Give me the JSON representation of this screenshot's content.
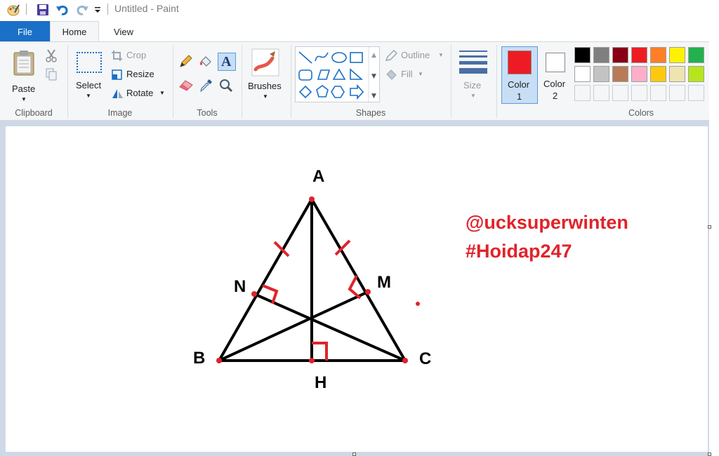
{
  "titlebar": {
    "title": "Untitled - Paint"
  },
  "tabs": {
    "file": "File",
    "home": "Home",
    "view": "View"
  },
  "clipboard": {
    "paste_label": "Paste",
    "group_label": "Clipboard"
  },
  "image": {
    "select_label": "Select",
    "crop_label": "Crop",
    "resize_label": "Resize",
    "rotate_label": "Rotate",
    "group_label": "Image"
  },
  "tools": {
    "group_label": "Tools"
  },
  "brushes": {
    "label": "Brushes"
  },
  "shapes": {
    "outline_label": "Outline",
    "fill_label": "Fill",
    "group_label": "Shapes"
  },
  "size": {
    "label": "Size"
  },
  "color1": {
    "label": "Color",
    "number": "1",
    "value": "#ed1c24"
  },
  "color2": {
    "label": "Color",
    "number": "2",
    "value": "#ffffff"
  },
  "colors": {
    "group_label": "Colors",
    "palette_row1": [
      "#000000",
      "#7f7f7f",
      "#880015",
      "#ed1c24",
      "#ff7f27",
      "#fff200",
      "#22b14c"
    ],
    "palette_row2": [
      "#ffffff",
      "#c3c3c3",
      "#b97a57",
      "#ffaec9",
      "#ffc90e",
      "#efe4b0",
      "#b5e61d"
    ]
  },
  "drawing": {
    "vertex_a": "A",
    "vertex_b": "B",
    "vertex_c": "C",
    "point_h": "H",
    "point_m": "M",
    "point_n": "N",
    "watermark_line1": "@ucksuperwinten",
    "watermark_line2": "#Hoidap247"
  }
}
